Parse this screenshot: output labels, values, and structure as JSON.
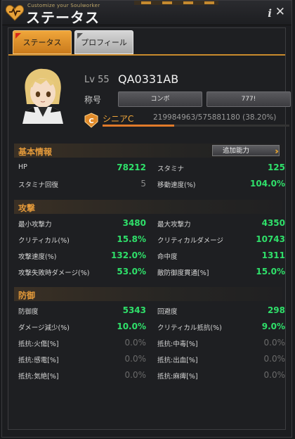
{
  "window": {
    "subtitle": "Customize your Soulworker",
    "title": "ステータス"
  },
  "tabs": [
    {
      "label": "ステータス",
      "active": true
    },
    {
      "label": "プロフィール",
      "active": false
    }
  ],
  "profile": {
    "level_label": "Lv 55",
    "name": "QA0331AB",
    "title_label": "称号",
    "title_buttons": [
      "コンボ",
      "777!"
    ],
    "rank_name": "シニアC",
    "exp_text": "219984963/575881180 (38.20%)",
    "exp_fraction": 0.382
  },
  "sections": {
    "basic": {
      "title": "基本情報",
      "add_button": "追加能力",
      "rows": [
        {
          "l_label": "HP",
          "l_val": "78212",
          "r_label": "スタミナ",
          "r_val": "125"
        },
        {
          "l_label": "スタミナ回復",
          "l_val": "5",
          "r_label": "移動速度(%)",
          "r_val": "104.0%"
        }
      ]
    },
    "attack": {
      "title": "攻撃",
      "rows": [
        {
          "l_label": "最小攻撃力",
          "l_val": "3480",
          "r_label": "最大攻撃力",
          "r_val": "4350"
        },
        {
          "l_label": "クリティカル(%)",
          "l_val": "15.8%",
          "r_label": "クリティカルダメージ",
          "r_val": "10743"
        },
        {
          "l_label": "攻撃速度(%)",
          "l_val": "132.0%",
          "r_label": "命中度",
          "r_val": "1311"
        },
        {
          "l_label": "攻撃失敗時ダメージ(%)",
          "l_val": "53.0%",
          "r_label": "敵防御度貫通[%]",
          "r_val": "15.0%"
        }
      ]
    },
    "defense": {
      "title": "防御",
      "rows": [
        {
          "l_label": "防御度",
          "l_val": "5343",
          "r_label": "回避度",
          "r_val": "298"
        },
        {
          "l_label": "ダメージ減少(%)",
          "l_val": "10.0%",
          "r_label": "クリティカル抵抗(%)",
          "r_val": "9.0%"
        },
        {
          "l_label": "抵抗:火傷[%]",
          "l_val": "0.0%",
          "r_label": "抵抗:中毒[%]",
          "r_val": "0.0%"
        },
        {
          "l_label": "抵抗:感電[%]",
          "l_val": "0.0%",
          "r_label": "抵抗:出血[%]",
          "r_val": "0.0%"
        },
        {
          "l_label": "抵抗:気絶[%]",
          "l_val": "0.0%",
          "r_label": "抵抗:麻痺[%]",
          "r_val": "0.0%"
        }
      ]
    }
  },
  "colors": {
    "accent": "#f0a63a",
    "value_green": "#2fe06a",
    "value_dim": "#6a6a6a"
  }
}
